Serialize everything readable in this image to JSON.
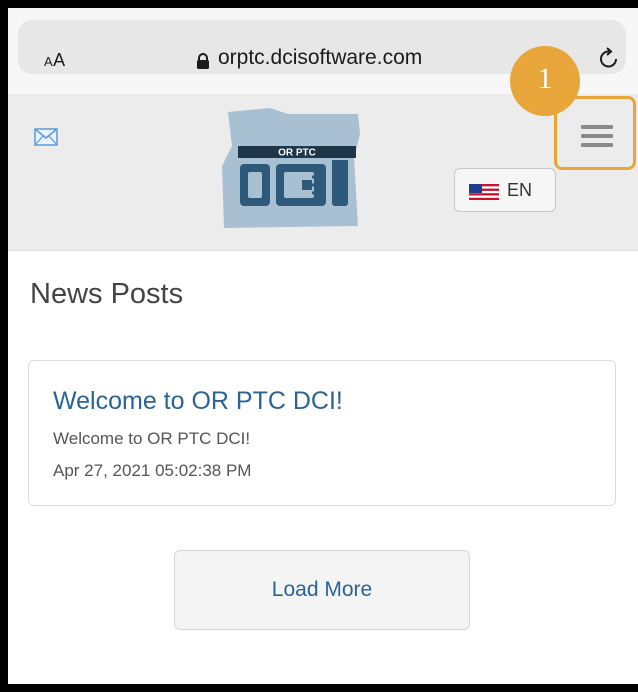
{
  "browser": {
    "text_size_label": "AA",
    "url": "orptc.dcisoftware.com",
    "lock_icon": "lock-icon",
    "reload_icon": "reload-icon"
  },
  "header": {
    "mail_icon": "mail-icon",
    "logo_text": "OR PTC",
    "logo_mark": "DCI",
    "language": {
      "flag_icon": "us-flag-icon",
      "label": "EN"
    },
    "menu_icon": "hamburger-menu-icon",
    "callout_number": "1"
  },
  "main": {
    "section_title": "News Posts",
    "posts": [
      {
        "title": "Welcome to OR PTC DCI!",
        "body": "Welcome to OR PTC DCI!",
        "date": "Apr 27, 2021 05:02:38 PM"
      }
    ],
    "load_more_label": "Load More"
  },
  "colors": {
    "accent_orange": "#e8a53a",
    "link_blue": "#2a6496",
    "header_bg": "#ececec"
  }
}
